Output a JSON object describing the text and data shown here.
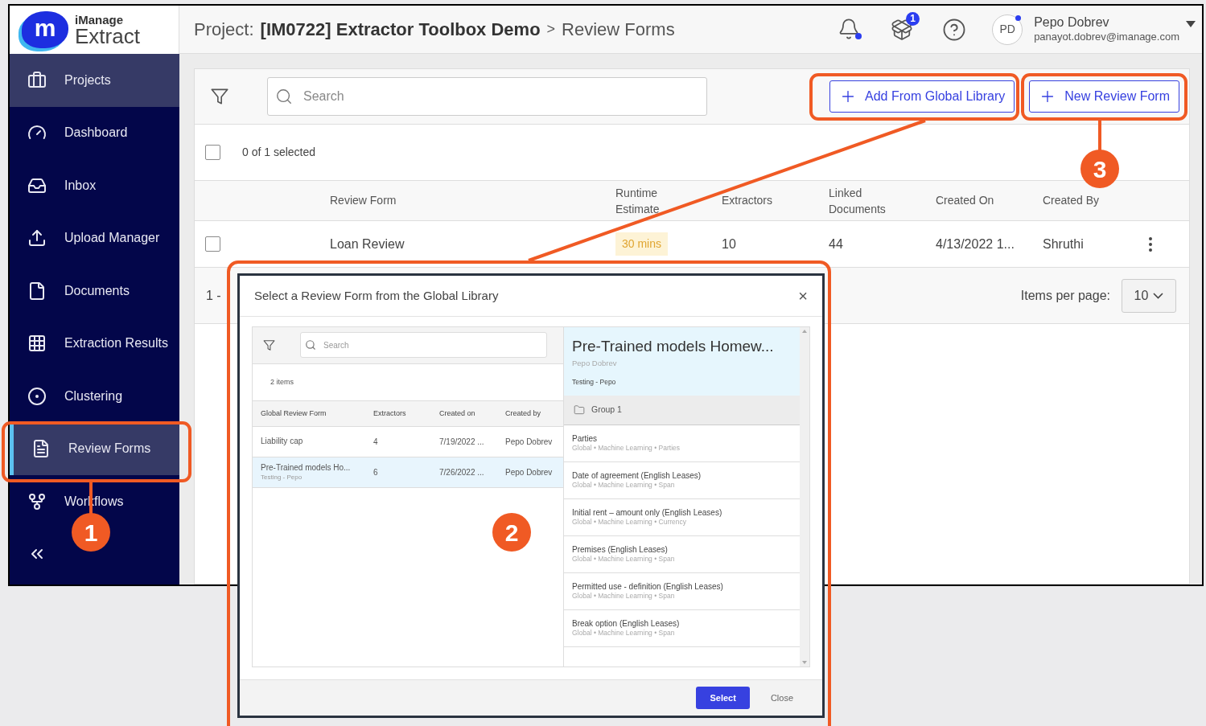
{
  "app": {
    "logo": {
      "monogram": "m",
      "brand": "iManage",
      "product": "Extract"
    },
    "sidebar": {
      "items": [
        {
          "label": "Projects",
          "kind": "project",
          "selected": false
        },
        {
          "label": "Dashboard",
          "kind": "page",
          "selected": false
        },
        {
          "label": "Inbox",
          "kind": "page",
          "selected": false
        },
        {
          "label": "Upload Manager",
          "kind": "page",
          "selected": false
        },
        {
          "label": "Documents",
          "kind": "page",
          "selected": false
        },
        {
          "label": "Extraction Results",
          "kind": "page",
          "selected": false
        },
        {
          "label": "Clustering",
          "kind": "page",
          "selected": false
        },
        {
          "label": "Review Forms",
          "kind": "page",
          "selected": true
        },
        {
          "label": "Workflows",
          "kind": "page",
          "selected": false
        }
      ]
    },
    "header": {
      "breadcrumb": {
        "prefix": "Project:",
        "project": "[IM0722] Extractor Toolbox Demo",
        "separator": ">",
        "page": "Review Forms"
      },
      "tasks_badge": "1",
      "user": {
        "initials": "PD",
        "name": "Pepo Dobrev",
        "email": "panayot.dobrev@imanage.com"
      }
    },
    "toolbar": {
      "search": {
        "placeholder": "Search"
      },
      "buttons": [
        "Add From Global Library",
        "New Review Form"
      ]
    },
    "selection": {
      "checked": false,
      "label": "0 of 1 selected"
    },
    "table": {
      "columns": [
        "Review Form",
        "Runtime Estimate",
        "Extractors",
        "Linked Documents",
        "Created On",
        "Created By"
      ],
      "rows": [
        {
          "checked": false,
          "name": "Loan Review",
          "runtime": "30 mins",
          "extractors": "10",
          "linked_documents": "44",
          "created_on": "4/13/2022 1...",
          "created_by": "Shruthi"
        }
      ]
    },
    "pagination": {
      "range": "1 -",
      "items_per_page_label": "Items per page:",
      "items_per_page": "10"
    }
  },
  "dialog": {
    "title": "Select a Review Form from the Global Library",
    "close": "×",
    "search": {
      "placeholder": "Search"
    },
    "count": "2 items",
    "columns": [
      "Global Review Form",
      "Extractors",
      "Created on",
      "Created by"
    ],
    "rows": [
      {
        "name": "Liability cap",
        "extractors": "4",
        "created_on": "7/19/2022 ...",
        "created_by": "Pepo Dobrev",
        "selected": false
      },
      {
        "name": "Pre-Trained models Ho...",
        "subtitle": "Testing - Pepo",
        "extractors": "6",
        "created_on": "7/26/2022 ...",
        "created_by": "Pepo Dobrev",
        "selected": true
      }
    ],
    "detail": {
      "title": "Pre-Trained models Homew...",
      "author": "Pepo Dobrev",
      "tag": "Testing - Pepo",
      "group": "Group 1",
      "fields": [
        {
          "name": "Parties",
          "meta": "Global • Machine Learning • Parties"
        },
        {
          "name": "Date of agreement (English Leases)",
          "meta": "Global • Machine Learning • Span"
        },
        {
          "name": "Initial rent – amount only (English Leases)",
          "meta": "Global • Machine Learning • Currency"
        },
        {
          "name": "Premises (English Leases)",
          "meta": "Global • Machine Learning • Span"
        },
        {
          "name": "Permitted use - definition (English Leases)",
          "meta": "Global • Machine Learning • Span"
        },
        {
          "name": "Break option (English Leases)",
          "meta": "Global • Machine Learning • Span"
        }
      ]
    },
    "buttons": {
      "primary": "Select",
      "secondary": "Close"
    }
  },
  "annotations": [
    {
      "label": "1"
    },
    {
      "label": "2"
    },
    {
      "label": "3"
    }
  ]
}
